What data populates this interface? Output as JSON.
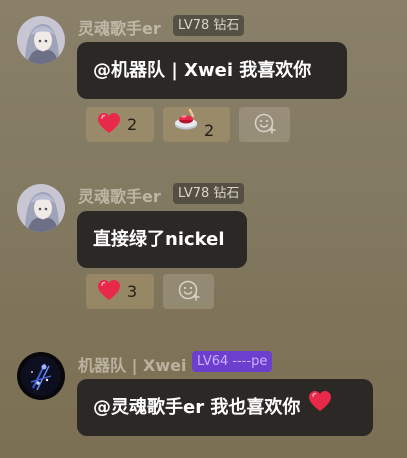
{
  "messages": [
    {
      "username": "灵魂歌手er",
      "badge": "LV78 钻石",
      "text": "@机器队 | Xwei 我喜欢你",
      "reactions": [
        {
          "icon": "heart-icon",
          "count": "2"
        },
        {
          "icon": "button-icon",
          "count": "2"
        }
      ]
    },
    {
      "username": "灵魂歌手er",
      "badge": "LV78 钻石",
      "text": "直接绿了nickel",
      "reactions": [
        {
          "icon": "heart-icon",
          "count": "3"
        }
      ]
    },
    {
      "username": "机器队 | Xwei",
      "badge": "LV64 ----pe",
      "text": "@灵魂歌手er 我也喜欢你",
      "trailing_icon": "heart-emoji-icon"
    }
  ],
  "colors": {
    "bubble": "#2b2826",
    "badge_gray": "#46423a",
    "badge_purple": "#6d3fcf",
    "heart": "#e8294a"
  }
}
